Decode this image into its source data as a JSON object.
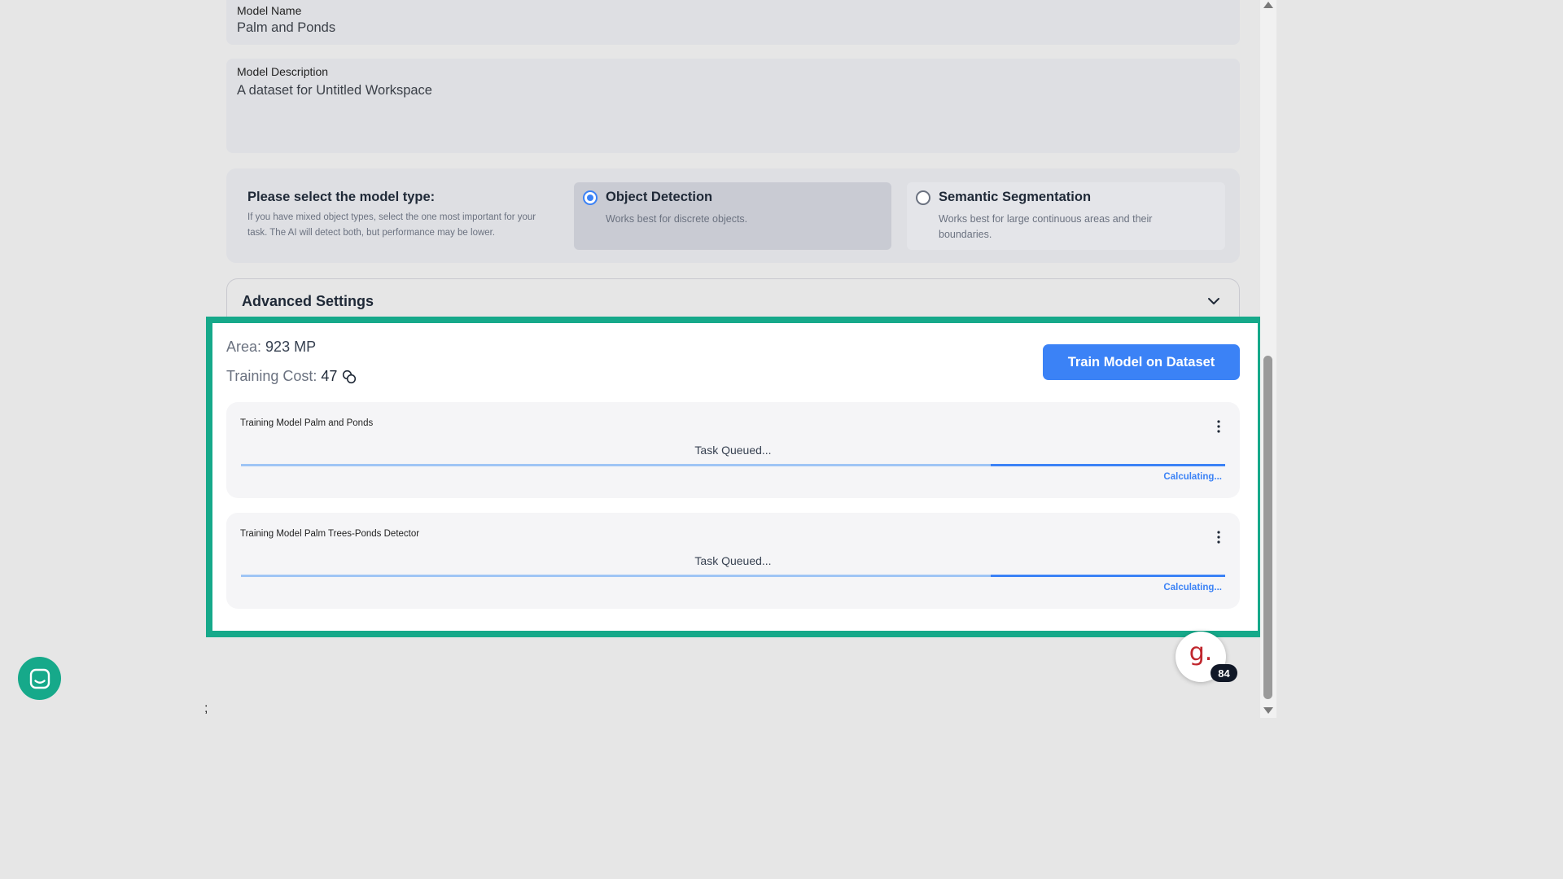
{
  "form": {
    "model_name_label": "Model Name",
    "model_name_value": "Palm and Ponds",
    "model_description_label": "Model Description",
    "model_description_value": "A dataset for Untitled Workspace"
  },
  "model_type": {
    "prompt_title": "Please select the model type:",
    "prompt_help": "If you have mixed object types, select the one most important for your task. The AI will detect both, but performance may be lower.",
    "options": [
      {
        "title": "Object Detection",
        "description": "Works best for discrete objects.",
        "selected": true
      },
      {
        "title": "Semantic Segmentation",
        "description": "Works best for large continuous areas and their boundaries.",
        "selected": false
      }
    ]
  },
  "advanced": {
    "title": "Advanced Settings",
    "icon": "chevron-down-icon"
  },
  "summary": {
    "area_label": "Area:",
    "area_value": "923 MP",
    "cost_label": "Training Cost:",
    "cost_value": "47",
    "cost_icon": "coins-icon"
  },
  "train_button": "Train Model on Dataset",
  "tasks": [
    {
      "name": "Training Model Palm and Ponds",
      "status": "Task Queued...",
      "progress_note": "Calculating...",
      "indicator_start": 0.762,
      "indicator_end": 1.0
    },
    {
      "name": "Training Model Palm Trees-Ponds Detector",
      "status": "Task Queued...",
      "progress_note": "Calculating...",
      "indicator_start": 0.762,
      "indicator_end": 1.0
    }
  ],
  "widgets": {
    "chat_icon": "chat-icon",
    "notification_logo": "g.",
    "notification_count": "84",
    "stray_text": ";"
  },
  "colors": {
    "accent": "#3b82f6",
    "highlight_border": "#16a98a",
    "chat_button": "#16a98a",
    "badge_bg": "#111827",
    "logo_red": "#c0262d"
  }
}
